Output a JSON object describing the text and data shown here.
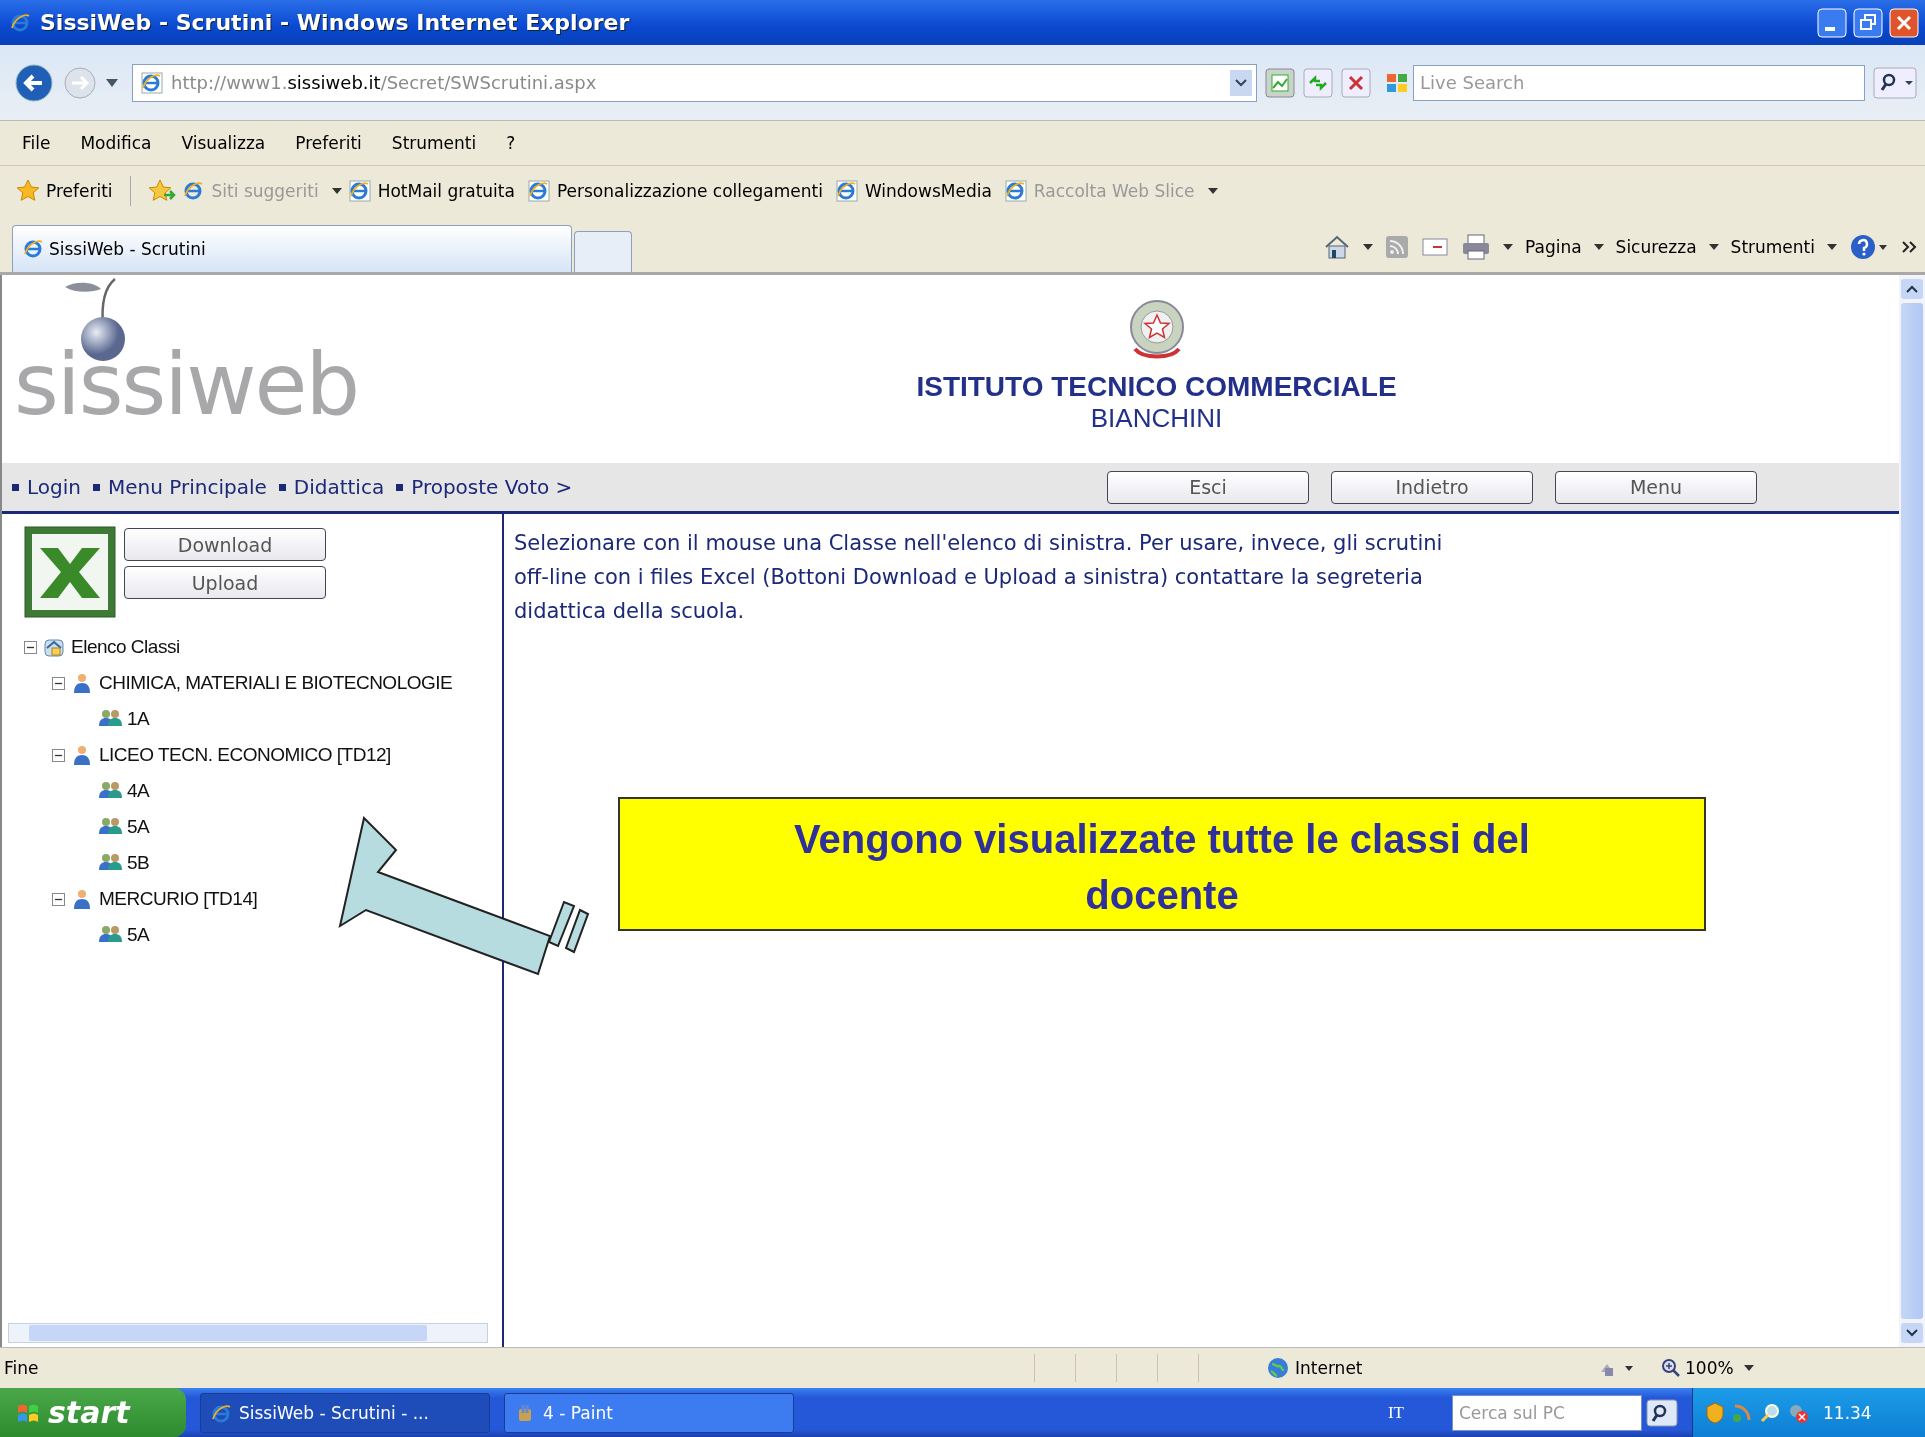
{
  "window": {
    "title": "SissiWeb - Scrutini - Windows Internet Explorer"
  },
  "address_bar": {
    "url_prefix": "http://www1.",
    "url_domain": "sissiweb.it",
    "url_path": "/Secret/SWScrutini.aspx"
  },
  "search": {
    "placeholder": "Live Search"
  },
  "menu": [
    "File",
    "Modifica",
    "Visualizza",
    "Preferiti",
    "Strumenti",
    "?"
  ],
  "favorites_bar": {
    "label": "Preferiti",
    "links": [
      {
        "label": "Siti suggeriti",
        "disabled": true,
        "dropdown": true
      },
      {
        "label": "HotMail gratuita",
        "disabled": false,
        "dropdown": false
      },
      {
        "label": "Personalizzazione collegamenti",
        "disabled": false,
        "dropdown": false
      },
      {
        "label": "WindowsMedia",
        "disabled": false,
        "dropdown": false
      },
      {
        "label": "Raccolta Web Slice",
        "disabled": true,
        "dropdown": true
      }
    ]
  },
  "tabs": [
    {
      "label": "SissiWeb - Scrutini",
      "selected": true
    }
  ],
  "command_bar": [
    "Pagina",
    "Sicurezza",
    "Strumenti"
  ],
  "page": {
    "logo": "sissiweb",
    "school": [
      "ISTITUTO TECNICO COMMERCIALE",
      "BIANCHINI"
    ],
    "breadcrumb": [
      "Login",
      "Menu Principale",
      "Didattica",
      "Proposte Voto >"
    ],
    "nav_buttons": [
      "Esci",
      "Indietro",
      "Menu"
    ],
    "file_buttons": [
      "Download",
      "Upload"
    ],
    "tree": [
      {
        "kind": "root",
        "label": "Elenco Classi",
        "expanded": true,
        "children": [
          {
            "kind": "course",
            "label": "CHIMICA, MATERIALI E BIOTECNOLOGIE",
            "expanded": true,
            "children": [
              {
                "kind": "class",
                "label": "1A"
              }
            ]
          },
          {
            "kind": "course",
            "label": "LICEO TECN. ECONOMICO [TD12]",
            "expanded": true,
            "children": [
              {
                "kind": "class",
                "label": "4A"
              },
              {
                "kind": "class",
                "label": "5A"
              },
              {
                "kind": "class",
                "label": "5B"
              }
            ]
          },
          {
            "kind": "course",
            "label": "MERCURIO [TD14]",
            "expanded": true,
            "children": [
              {
                "kind": "class",
                "label": "5A"
              }
            ]
          }
        ]
      }
    ],
    "instructions": "Selezionare con il mouse una Classe nell'elenco di sinistra. Per usare, invece, gli scrutini off-line con i files Excel (Bottoni Download e Upload a sinistra) contattare la segreteria didattica della scuola.",
    "callout": "Vengono visualizzate tutte le classi del docente"
  },
  "status_bar": {
    "text": "Fine",
    "zone": "Internet",
    "zoom": "100%"
  },
  "taskbar": {
    "start": "start",
    "tasks": [
      {
        "label": "SissiWeb - Scrutini - ...",
        "selected": true
      },
      {
        "label": "4 - Paint",
        "selected": false
      }
    ],
    "language": "IT",
    "search_placeholder": "Cerca sul PC",
    "clock": "11.34"
  }
}
